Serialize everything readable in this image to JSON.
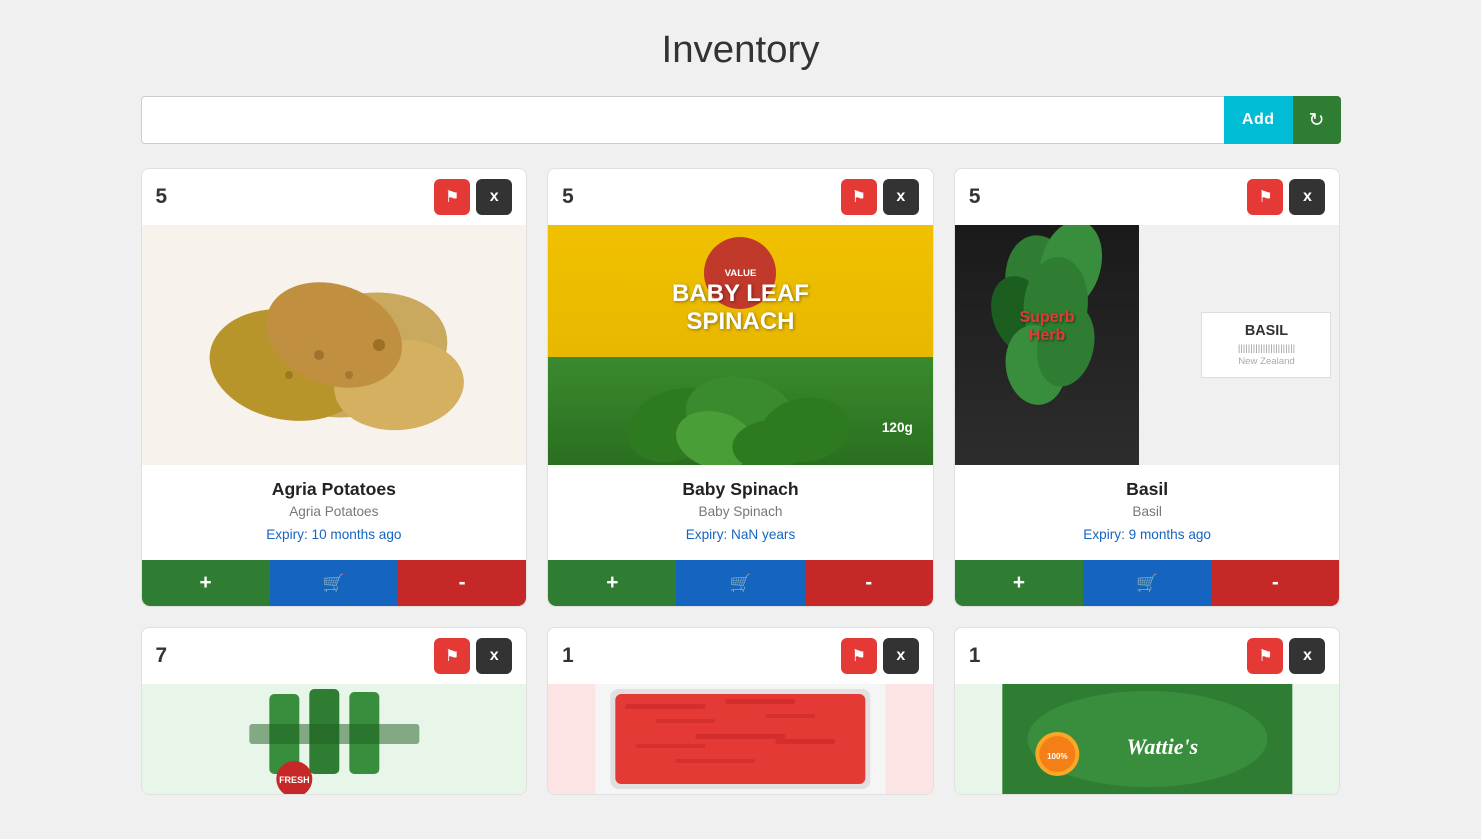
{
  "page": {
    "title": "Inventory"
  },
  "search": {
    "placeholder": "",
    "value": "",
    "add_label": "Add"
  },
  "cards": [
    {
      "id": "agria-potatoes",
      "count": "5",
      "title": "Agria Potatoes",
      "subtitle": "Agria Potatoes",
      "expiry_label": "Expiry:",
      "expiry_value": "10 months ago",
      "image_type": "potato"
    },
    {
      "id": "baby-spinach",
      "count": "5",
      "title": "Baby Spinach",
      "subtitle": "Baby Spinach",
      "expiry_label": "Expiry:",
      "expiry_value": "NaN years",
      "image_type": "spinach"
    },
    {
      "id": "basil",
      "count": "5",
      "title": "Basil",
      "subtitle": "Basil",
      "expiry_label": "Expiry:",
      "expiry_value": "9 months ago",
      "image_type": "basil"
    },
    {
      "id": "green-veg",
      "count": "7",
      "title": "",
      "subtitle": "",
      "expiry_label": "",
      "expiry_value": "",
      "image_type": "green-veg"
    },
    {
      "id": "mince",
      "count": "1",
      "title": "",
      "subtitle": "",
      "expiry_label": "",
      "expiry_value": "",
      "image_type": "meat"
    },
    {
      "id": "watties",
      "count": "1",
      "title": "",
      "subtitle": "",
      "expiry_label": "",
      "expiry_value": "",
      "image_type": "wattie"
    }
  ],
  "buttons": {
    "plus": "+",
    "minus": "-",
    "flag": "⚑",
    "close": "x",
    "refresh": "↻"
  },
  "colors": {
    "add_btn": "#00bcd4",
    "refresh_btn": "#2e7d32",
    "flag_btn": "#e53935",
    "close_btn": "#333333",
    "plus_btn": "#2e7d32",
    "cart_btn": "#1565c0",
    "minus_btn": "#c62828"
  }
}
